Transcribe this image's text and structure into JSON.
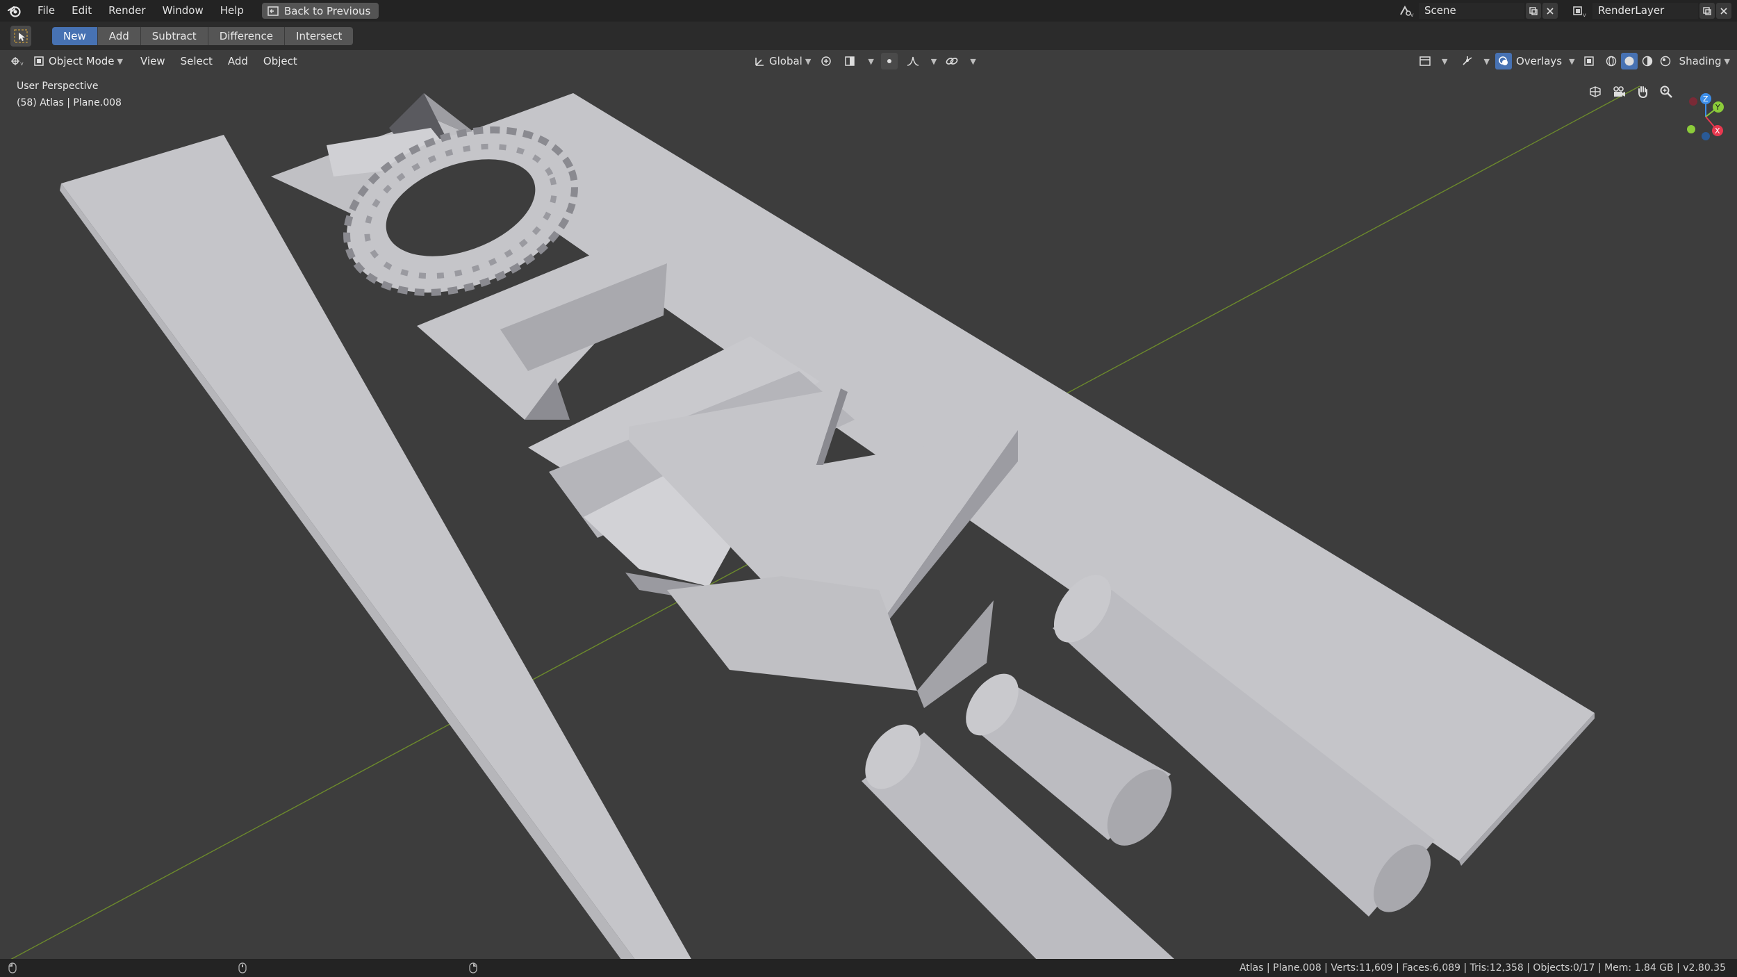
{
  "menu": {
    "items": [
      "File",
      "Edit",
      "Render",
      "Window",
      "Help"
    ],
    "back_button": "Back to Previous"
  },
  "scene_selector": {
    "value": "Scene"
  },
  "layer_selector": {
    "value": "RenderLayer"
  },
  "boolean_toolbar": {
    "buttons": [
      "New",
      "Add",
      "Subtract",
      "Difference",
      "Intersect"
    ],
    "active": "New"
  },
  "view_header": {
    "mode": "Object Mode",
    "menus": [
      "View",
      "Select",
      "Add",
      "Object"
    ],
    "transform_orientation": "Global",
    "overlays_label": "Overlays",
    "shading_label": "Shading"
  },
  "viewport": {
    "view_name": "User Perspective",
    "object_info": "(58) Atlas | Plane.008",
    "background_color": "#3d3d3d",
    "object_color": "#c8c8cc"
  },
  "gizmo": {
    "axes": [
      "Z",
      "Y",
      "X"
    ],
    "colors": {
      "x": "#e8384f",
      "y": "#8ccc3a",
      "z": "#3d8ee8"
    }
  },
  "status": {
    "text": "Atlas | Plane.008 | Verts:11,609 | Faces:6,089 | Tris:12,358 | Objects:0/17 | Mem: 1.84 GB | v2.80.35"
  },
  "colors": {
    "accent": "#4772b3",
    "topbar": "#232323"
  }
}
